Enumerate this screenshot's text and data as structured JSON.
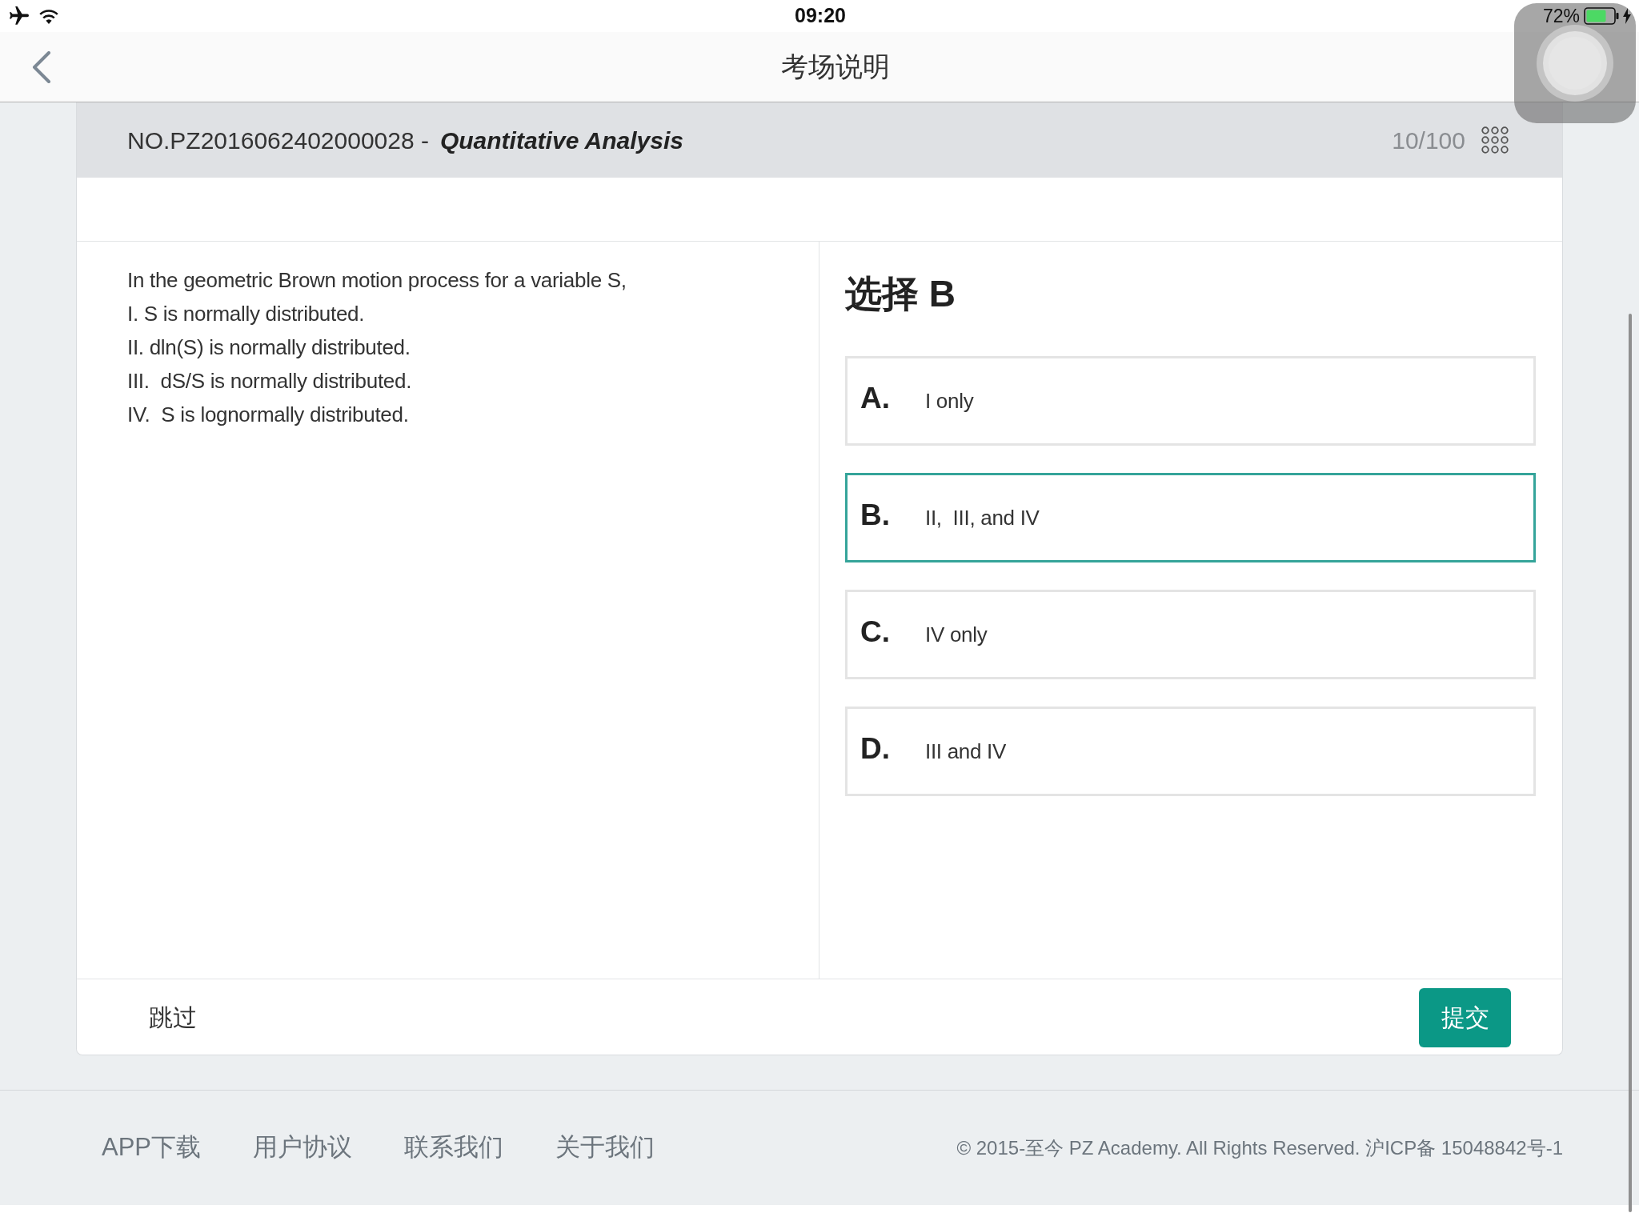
{
  "status_bar": {
    "time": "09:20",
    "battery": "72%"
  },
  "nav_bar": {
    "title": "考场说明"
  },
  "exam": {
    "code": "NO.PZ2016062402000028 -",
    "subject": "Quantitative Analysis",
    "progress": "10/100"
  },
  "question": {
    "lines": [
      "In the geometric Brown motion process for a variable S,",
      "I. S is normally distributed.",
      "II. dln(S) is normally distributed.",
      "III.  dS/S is normally distributed.",
      "IV.  S is lognormally distributed."
    ]
  },
  "answer": {
    "heading": "选择 B",
    "options": [
      {
        "letter": "A.",
        "text": "I only",
        "selected": false
      },
      {
        "letter": "B.",
        "text": "II,  III, and IV",
        "selected": true
      },
      {
        "letter": "C.",
        "text": "IV only",
        "selected": false
      },
      {
        "letter": "D.",
        "text": "III and IV",
        "selected": false
      }
    ]
  },
  "actions": {
    "skip": "跳过",
    "submit": "提交"
  },
  "footer": {
    "links": [
      "APP下载",
      "用户协议",
      "联系我们",
      "关于我们"
    ],
    "copyright": "© 2015-至今 PZ Academy. All Rights Reserved. 沪ICP备 15048842号-1"
  }
}
